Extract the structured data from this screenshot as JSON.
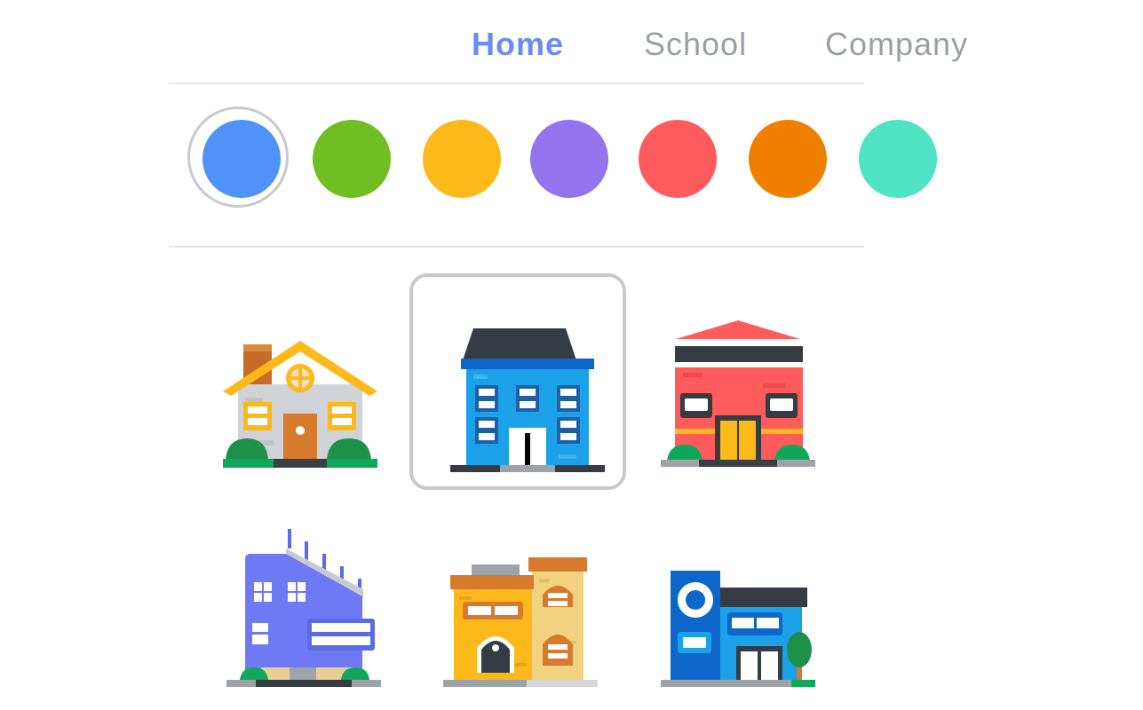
{
  "tabs": [
    {
      "label": "Home",
      "active": true
    },
    {
      "label": "School",
      "active": false
    },
    {
      "label": "Company",
      "active": false
    }
  ],
  "colors": {
    "options": [
      "#4f93f8",
      "#6fbe22",
      "#fdb81a",
      "#9274ee",
      "#fe5b5c",
      "#f07f00",
      "#4fe3c4"
    ],
    "selected_index": 0,
    "tab_active": "#6a8bf5",
    "tab_inactive": "#9a9ea6"
  },
  "buildings": [
    {
      "icon": "house-icon",
      "selected": false
    },
    {
      "icon": "townhouse-icon",
      "selected": true
    },
    {
      "icon": "warehouse-icon",
      "selected": false
    },
    {
      "icon": "solar-building-icon",
      "selected": false
    },
    {
      "icon": "apartment-icon",
      "selected": false
    },
    {
      "icon": "shop-icon",
      "selected": false
    }
  ]
}
